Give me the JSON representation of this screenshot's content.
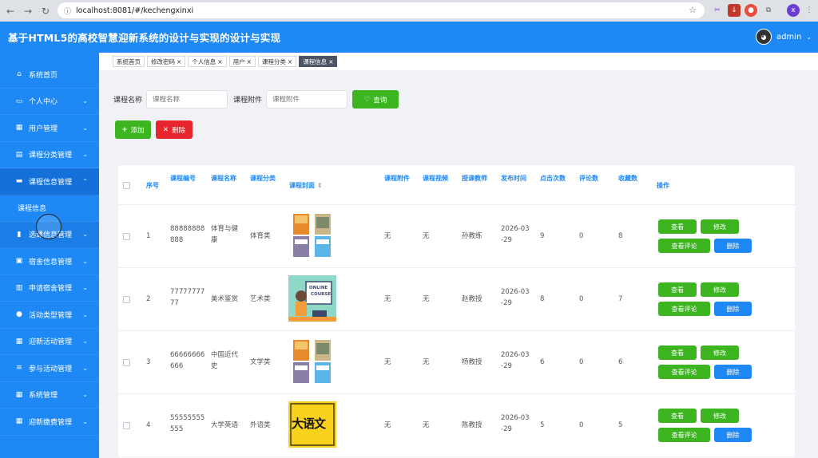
{
  "browser": {
    "url": "localhost:8081/#/kechengxinxi"
  },
  "header": {
    "title": "基于HTML5的高校智慧迎新系统的设计与实现的设计与实现",
    "username": "admin"
  },
  "sidebar": {
    "items": [
      {
        "label": "系统首页",
        "icon": "home-icon",
        "chevron": false
      },
      {
        "label": "个人中心",
        "icon": "monitor-icon",
        "chevron": true
      },
      {
        "label": "用户管理",
        "icon": "grid-icon",
        "chevron": true
      },
      {
        "label": "课程分类管理",
        "icon": "clipboard-icon",
        "chevron": true
      },
      {
        "label": "课程信息管理",
        "icon": "briefcase-icon",
        "chevron": true,
        "expanded": true
      },
      {
        "label": "课程信息",
        "sub": true
      },
      {
        "label": "选课信息管理",
        "icon": "book-icon",
        "chevron": true
      },
      {
        "label": "宿舍信息管理",
        "icon": "calendar-check-icon",
        "chevron": true
      },
      {
        "label": "申请宿舍管理",
        "icon": "bar-chart-icon",
        "chevron": true
      },
      {
        "label": "活动类型管理",
        "icon": "user-icon",
        "chevron": true
      },
      {
        "label": "迎新活动管理",
        "icon": "grid-icon",
        "chevron": true
      },
      {
        "label": "参与活动管理",
        "icon": "menu-icon",
        "chevron": true
      },
      {
        "label": "系统管理",
        "icon": "grid-icon",
        "chevron": true
      },
      {
        "label": "迎新缴费管理",
        "icon": "grid-icon",
        "chevron": true
      }
    ]
  },
  "tabs": [
    {
      "label": "系统首页",
      "closable": false
    },
    {
      "label": "修改密码",
      "closable": true
    },
    {
      "label": "个人信息",
      "closable": true
    },
    {
      "label": "用户",
      "closable": true
    },
    {
      "label": "课程分类",
      "closable": true
    },
    {
      "label": "课程信息",
      "closable": true,
      "active": true
    }
  ],
  "search": {
    "name_label": "课程名称",
    "name_placeholder": "课程名称",
    "attach_label": "课程附件",
    "attach_placeholder": "课程附件",
    "query_button": "查询"
  },
  "toolbar": {
    "add_button": "添加",
    "delete_button": "删除"
  },
  "table": {
    "headers": {
      "index": "序号",
      "code": "课程编号",
      "name": "课程名称",
      "category": "课程分类",
      "cover": "课程封面",
      "attachment": "课程附件",
      "video": "课程视频",
      "teacher": "授课教师",
      "publish_time": "发布时间",
      "clicks": "点击次数",
      "comments": "评论数",
      "favorites": "收藏数",
      "ops": "操作"
    },
    "rows": [
      {
        "index": "1",
        "code_1": "88888888",
        "code_2": "888",
        "name_1": "体育与健",
        "name_2": "康",
        "category": "体育类",
        "attachment": "无",
        "video": "无",
        "teacher": "孙教练",
        "time_1": "2026-03",
        "time_2": "-29",
        "clicks": "9",
        "comments": "0",
        "favorites": "8",
        "cover": "books"
      },
      {
        "index": "2",
        "code_1": "77777777",
        "code_2": "77",
        "name_1": "美术鉴赏",
        "name_2": "",
        "category": "艺术类",
        "attachment": "无",
        "video": "无",
        "teacher": "赵教授",
        "time_1": "2026-03",
        "time_2": "-29",
        "clicks": "8",
        "comments": "0",
        "favorites": "7",
        "cover": "online",
        "cover_text_1": "ONLINE",
        "cover_text_2": "COURSE"
      },
      {
        "index": "3",
        "code_1": "66666666",
        "code_2": "666",
        "name_1": "中国近代",
        "name_2": "史",
        "category": "文学类",
        "attachment": "无",
        "video": "无",
        "teacher": "杨教授",
        "time_1": "2026-03",
        "time_2": "-29",
        "clicks": "6",
        "comments": "0",
        "favorites": "6",
        "cover": "books"
      },
      {
        "index": "4",
        "code_1": "55555555",
        "code_2": "555",
        "name_1": "大学英语",
        "name_2": "",
        "category": "外语类",
        "attachment": "无",
        "video": "无",
        "teacher": "陈教授",
        "time_1": "2026-03",
        "time_2": "-29",
        "clicks": "5",
        "comments": "0",
        "favorites": "5",
        "cover": "yuwen",
        "cover_text_1": "大语文"
      }
    ],
    "row_actions": {
      "view": "查看",
      "edit": "修改",
      "view_comments": "查看评论",
      "delete": "删除"
    }
  },
  "colors": {
    "primary": "#1e88f5",
    "success": "#3cb521",
    "danger": "#e8242c"
  }
}
